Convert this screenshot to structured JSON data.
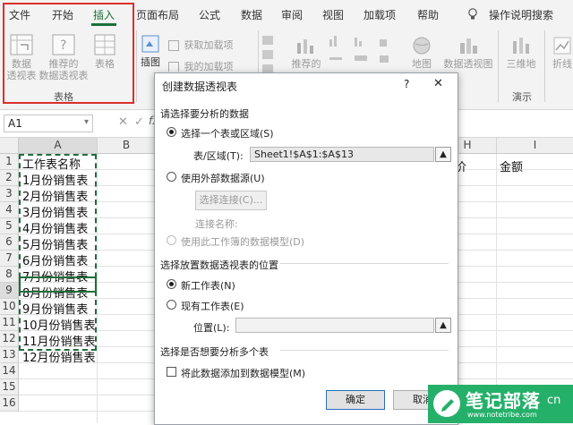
{
  "ribbon": {
    "tabs": [
      "文件",
      "开始",
      "插入",
      "页面布局",
      "公式",
      "数据",
      "审阅",
      "视图",
      "加载项",
      "帮助"
    ],
    "tell_me": "操作说明搜索",
    "tables_group": {
      "label": "表格",
      "pivot_table": "数据\n透视表",
      "recommended_pivot": "推荐的\n数据透视表",
      "table": "表格"
    },
    "illustrations": {
      "label": "插图"
    },
    "addins": {
      "get": "获取加载项",
      "my": "我的加载项"
    },
    "charts": {
      "recommended": "推荐的",
      "map": "地图",
      "pivot_chart": "数据透视图"
    },
    "tours": {
      "map3d": "三维地",
      "label": "演示"
    },
    "sparklines": {
      "line": "折线"
    }
  },
  "formula_bar": {
    "name_box": "A1",
    "cancel_icon": "close-icon",
    "enter_icon": "check-icon",
    "fx": "fx"
  },
  "sheet": {
    "columns": [
      "A",
      "B",
      "H",
      "I"
    ],
    "rows": [
      "1",
      "2",
      "3",
      "4",
      "5",
      "6",
      "7",
      "8",
      "9",
      "10",
      "11",
      "12",
      "13",
      "14",
      "15",
      "16"
    ],
    "a_values": [
      "工作表名称",
      "1月份销售表",
      "2月份销售表",
      "3月份销售表",
      "4月份销售表",
      "5月份销售表",
      "6月份销售表",
      "7月份销售表",
      "8月份销售表",
      "9月份销售表",
      "10月份销售表",
      "11月份销售表",
      "12月份销售表"
    ],
    "h1": "价",
    "i1": "金额"
  },
  "dialog": {
    "title": "创建数据透视表",
    "help": "?",
    "close": "✕",
    "section1": "请选择要分析的数据",
    "opt_select_table": "选择一个表或区域(S)",
    "range_label": "表/区域(T):",
    "range_value": "Sheet1!$A$1:$A$13",
    "opt_external": "使用外部数据源(U)",
    "choose_connection": "选择连接(C)...",
    "connection_name": "连接名称:",
    "opt_data_model": "使用此工作簿的数据模型(D)",
    "section2": "选择放置数据透视表的位置",
    "opt_new_sheet": "新工作表(N)",
    "opt_existing_sheet": "现有工作表(E)",
    "location_label": "位置(L):",
    "location_value": "",
    "section3": "选择是否想要分析多个表",
    "add_to_model": "将此数据添加到数据模型(M)",
    "ok": "确定",
    "cancel": "取消"
  },
  "watermark": {
    "title": "笔记部落",
    "url": "www.notetribe.com",
    "suffix": "cn"
  },
  "colors": {
    "accent": "#1e6e3a",
    "highlight": "#d9302c",
    "watermark": "#25b06a"
  }
}
